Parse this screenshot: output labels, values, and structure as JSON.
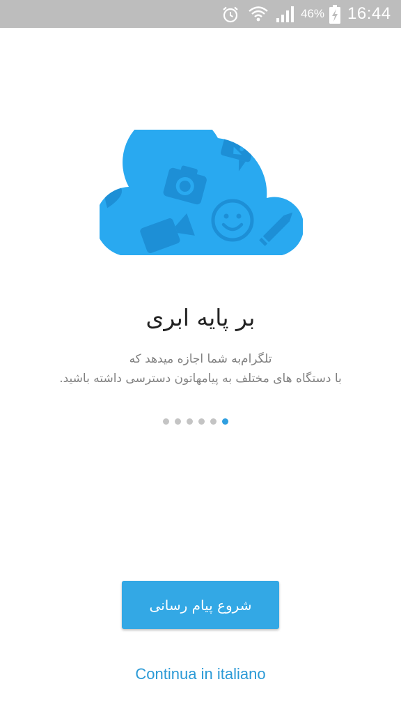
{
  "status_bar": {
    "battery_percent": "46%",
    "time": "16:44",
    "icons": [
      "alarm-icon",
      "wifi-icon",
      "signal-icon",
      "battery-charging-icon"
    ]
  },
  "intro": {
    "title": "بر پایه ابری",
    "description_line1": "تلگرام‌به شما اجازه میدهد که",
    "description_line2": "با دستگاه های مختلف به پیامهاتون دسترسی داشته باشید.",
    "page_count": 6,
    "active_page": 6,
    "illustration_icons": [
      "location-pin-icon",
      "camera-icon",
      "chat-bubble-icon",
      "video-camera-icon",
      "smiley-icon",
      "pencil-icon"
    ]
  },
  "actions": {
    "start_messaging": "شروع پیام رسانی",
    "language_link": "Continua in italiano"
  },
  "colors": {
    "accent": "#33a8e5",
    "cloud": "#29a9f0",
    "link": "#2b9ad6",
    "status_bar": "#bdbdbd"
  }
}
